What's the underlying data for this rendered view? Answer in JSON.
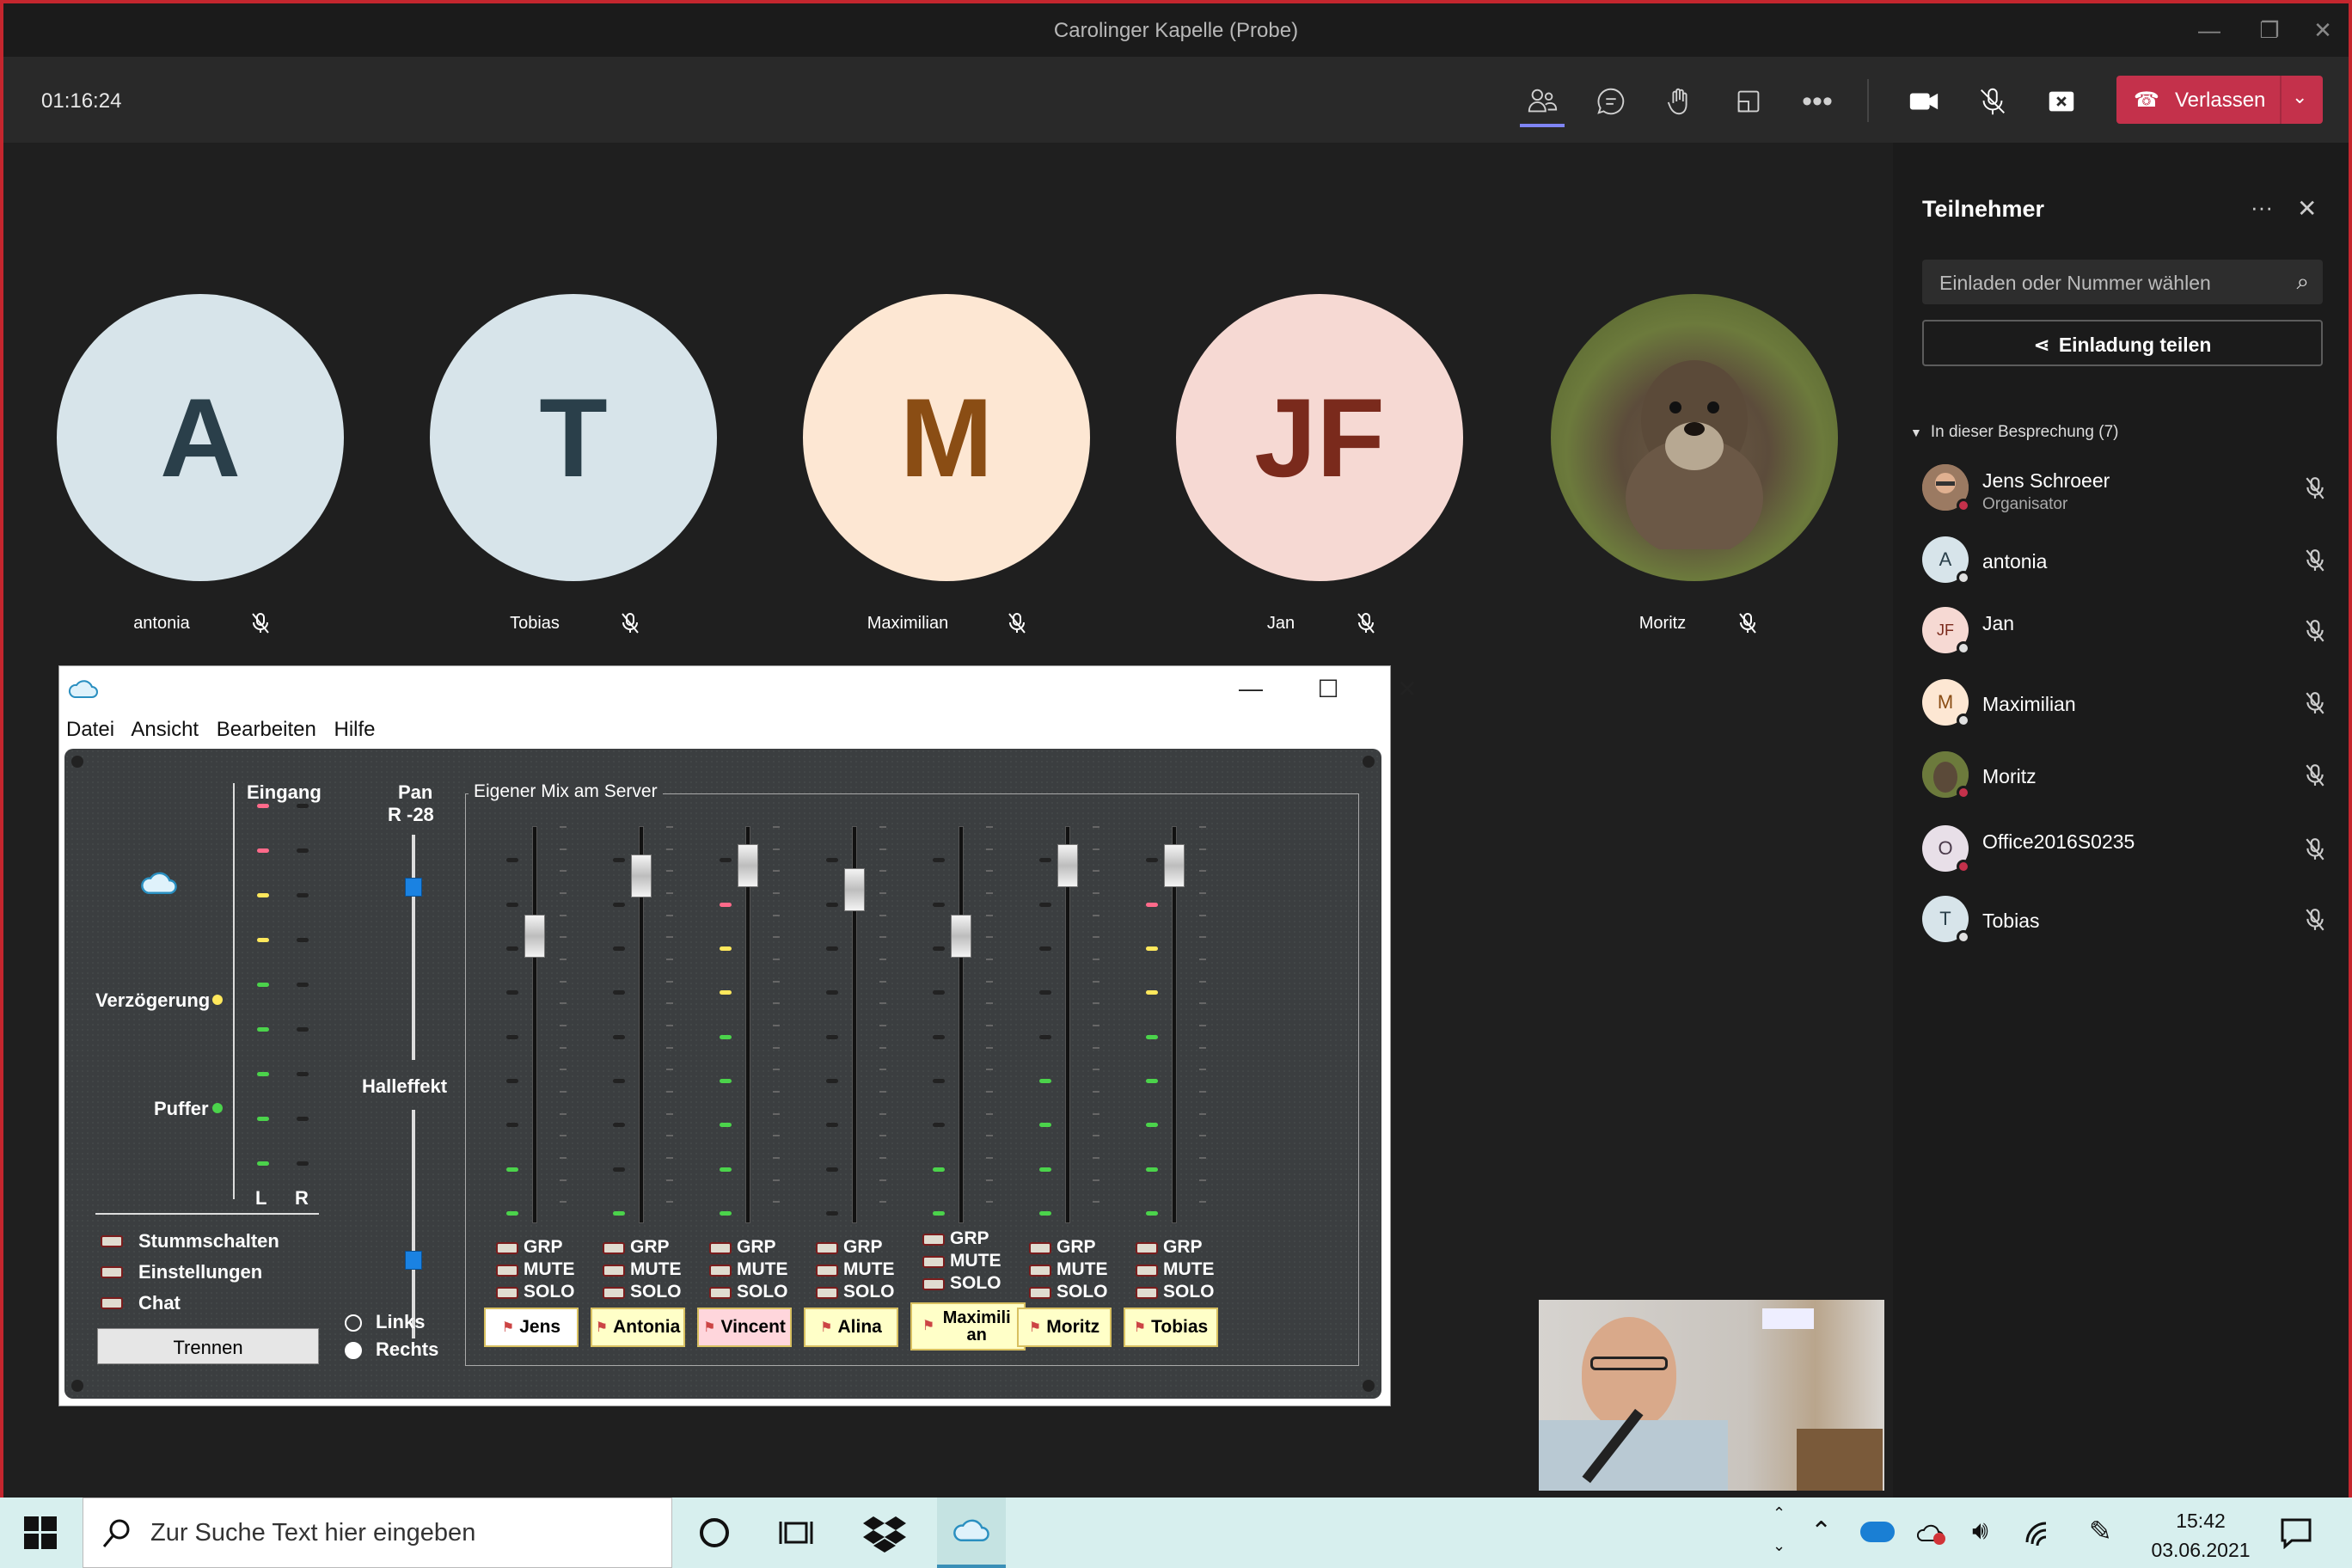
{
  "window": {
    "title": "Carolinger Kapelle (Probe)"
  },
  "toolbar": {
    "timer": "01:16:24",
    "leave_label": "Verlassen"
  },
  "stage": {
    "participants": [
      {
        "initial": "A",
        "name": "antonia",
        "bg": "#d7e4ea",
        "fg": "#2a3f4a"
      },
      {
        "initial": "T",
        "name": "Tobias",
        "bg": "#d7e4ea",
        "fg": "#2a3f4a"
      },
      {
        "initial": "M",
        "name": "Maximilian",
        "bg": "#fde7d3",
        "fg": "#8a4d14"
      },
      {
        "initial": "JF",
        "name": "Jan",
        "bg": "#f6d9d3",
        "fg": "#7a2a1c"
      },
      {
        "initial": "",
        "name": "Moritz",
        "bg": "#5a6b3a",
        "fg": "#ffffff"
      }
    ]
  },
  "panel": {
    "title": "Teilnehmer",
    "invite_placeholder": "Einladen oder Nummer wählen",
    "share_label": "Einladung teilen",
    "section_label": "In dieser Besprechung (7)",
    "people": [
      {
        "initial": "",
        "name": "Jens Schroeer",
        "role": "Organisator",
        "bg": "#b08060",
        "dot": "#c4314b"
      },
      {
        "initial": "A",
        "name": "antonia",
        "role": "",
        "bg": "#d7e4ea",
        "dot": "#e0e0e0"
      },
      {
        "initial": "JF",
        "name": "Jan",
        "role": "",
        "bg": "#f6d9d3",
        "dot": "#e0e0e0"
      },
      {
        "initial": "M",
        "name": "Maximilian",
        "role": "",
        "bg": "#fde7d3",
        "dot": "#e0e0e0"
      },
      {
        "initial": "",
        "name": "Moritz",
        "role": "",
        "bg": "#5a6b3a",
        "dot": "#c4314b"
      },
      {
        "initial": "O",
        "name": "Office2016S0235",
        "role": "",
        "bg": "#e8dfe8",
        "dot": "#c4314b"
      },
      {
        "initial": "T",
        "name": "Tobias",
        "role": "",
        "bg": "#d7e4ea",
        "dot": "#e0e0e0"
      }
    ]
  },
  "jamulus": {
    "menu": [
      "Datei",
      "Ansicht",
      "Bearbeiten",
      "Hilfe"
    ],
    "input_label": "Eingang",
    "lr_left": "L",
    "lr_right": "R",
    "delay_label": "Verzögerung",
    "buffer_label": "Puffer",
    "pan_label": "Pan",
    "pan_value": "R -28",
    "reverb_label": "Halleffekt",
    "radio_left": "Links",
    "radio_right": "Rechts",
    "mute_label": "Stummschalten",
    "settings_label": "Einstellungen",
    "chat_label": "Chat",
    "disconnect_label": "Trennen",
    "mix_title": "Eigener Mix am Server",
    "grp": "GRP",
    "mute": "MUTE",
    "solo": "SOLO",
    "channels": [
      {
        "name": "Jens",
        "fader_level": 0.75,
        "meter_level": 0.25
      },
      {
        "name": "Antonia",
        "fader_level": 0.92,
        "meter_level": 0.12
      },
      {
        "name": "Vincent",
        "fader_level": 0.95,
        "meter_level": 1.0
      },
      {
        "name": "Alina",
        "fader_level": 0.88,
        "meter_level": 0.0
      },
      {
        "name": "Maximilian",
        "fader_level": 0.75,
        "meter_level": 0.25
      },
      {
        "name": "Moritz",
        "fader_level": 0.95,
        "meter_level": 0.5
      },
      {
        "name": "Tobias",
        "fader_level": 0.95,
        "meter_level": 0.88
      }
    ]
  },
  "taskbar": {
    "search_placeholder": "Zur Suche Text hier eingeben",
    "time": "15:42",
    "date": "03.06.2021"
  }
}
